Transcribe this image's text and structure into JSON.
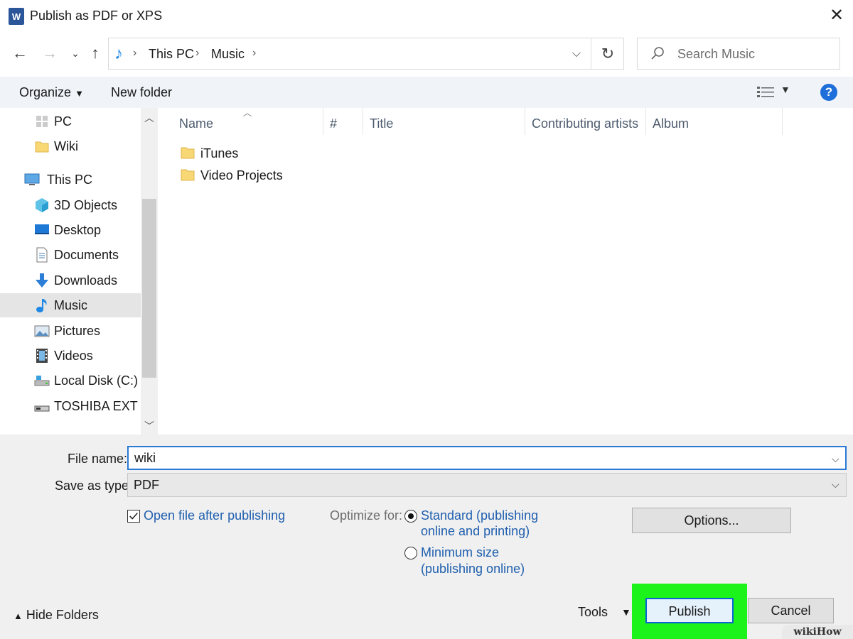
{
  "window": {
    "title": "Publish as PDF or XPS",
    "app_icon_letter": "W",
    "close_glyph": "✕"
  },
  "address_bar": {
    "breadcrumbs": [
      "This PC",
      "Music"
    ],
    "search_placeholder": "Search Music"
  },
  "toolbar": {
    "organize_label": "Organize",
    "new_folder_label": "New folder",
    "help_label": "?"
  },
  "nav_pane": {
    "items": [
      {
        "label": "PC",
        "icon": "pc-icon"
      },
      {
        "label": "Wiki",
        "icon": "folder-icon"
      },
      {
        "label": "This PC",
        "icon": "computer-icon"
      },
      {
        "label": "3D Objects",
        "icon": "cube-icon"
      },
      {
        "label": "Desktop",
        "icon": "desktop-icon"
      },
      {
        "label": "Documents",
        "icon": "document-icon"
      },
      {
        "label": "Downloads",
        "icon": "download-arrow-icon"
      },
      {
        "label": "Music",
        "icon": "music-note-icon",
        "selected": true
      },
      {
        "label": "Pictures",
        "icon": "picture-icon"
      },
      {
        "label": "Videos",
        "icon": "film-icon"
      },
      {
        "label": "Local Disk (C:)",
        "icon": "drive-icon"
      },
      {
        "label": "TOSHIBA EXT (E:)",
        "icon": "external-drive-icon"
      }
    ]
  },
  "file_list": {
    "columns": [
      "Name",
      "#",
      "Title",
      "Contributing artists",
      "Album"
    ],
    "rows": [
      {
        "name": "iTunes",
        "type": "folder"
      },
      {
        "name": "Video Projects",
        "type": "folder"
      }
    ]
  },
  "form": {
    "file_name_label": "File name:",
    "file_name_value": "wiki",
    "save_as_type_label": "Save as type:",
    "save_as_type_value": "PDF",
    "open_after_label": "Open file after publishing",
    "open_after_checked": true,
    "optimize_label": "Optimize for:",
    "standard_line1": "Standard (publishing",
    "standard_line2": "online and printing)",
    "minimum_line1": "Minimum size",
    "minimum_line2": "(publishing online)",
    "options_label": "Options..."
  },
  "footer": {
    "hide_folders_label": "Hide Folders",
    "tools_label": "Tools",
    "publish_label": "Publish",
    "cancel_label": "Cancel"
  },
  "watermark": "wikiHow",
  "colors": {
    "accent_blue": "#2a7ad5",
    "link_blue": "#1f5fae",
    "highlight_green": "#1bf31b"
  }
}
